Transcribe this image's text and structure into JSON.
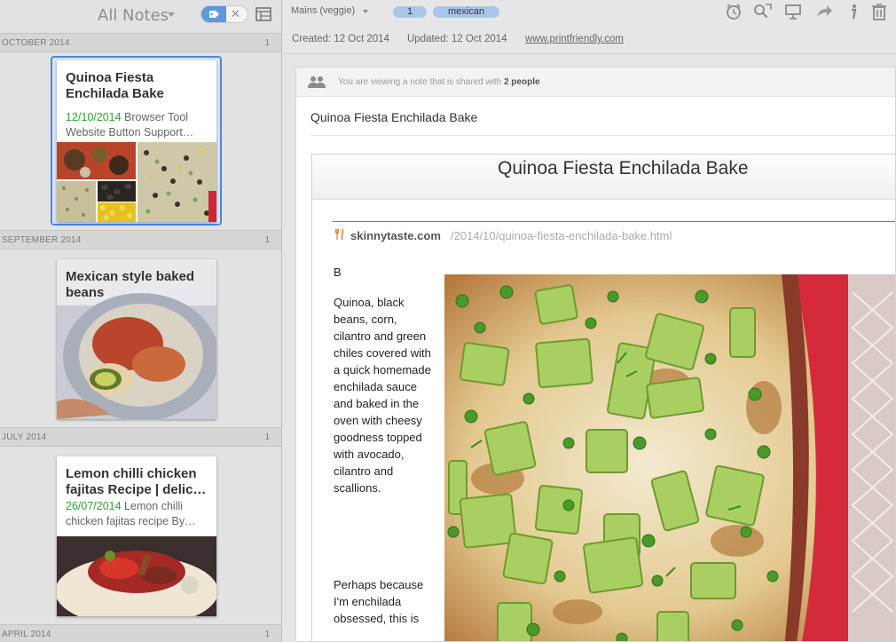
{
  "list": {
    "title": "All Notes",
    "groups": [
      {
        "month": "OCTOBER 2014",
        "count": "1"
      },
      {
        "month": "SEPTEMBER 2014",
        "count": "1"
      },
      {
        "month": "JULY 2014",
        "count": "1"
      },
      {
        "month": "APRIL 2014",
        "count": "1"
      }
    ],
    "notes": [
      {
        "title": "Quinoa Fiesta Enchilada Bake",
        "date": "12/10/2014",
        "snippet": " Browser Tool Website Button Support…"
      },
      {
        "title": "Mexican style baked beans"
      },
      {
        "title": "Lemon chilli chicken fajitas Recipe | delic…",
        "date": "26/07/2014",
        "snippet": " Lemon chilli chicken fajitas recipe By…"
      }
    ]
  },
  "note": {
    "notebook": "Mains (veggie)",
    "tags": [
      "1",
      "mexican"
    ],
    "created": "Created: 12 Oct 2014",
    "updated": "Updated: 12 Oct 2014",
    "source": "www.printfriendly.com",
    "share_prefix": "You are viewing a note that is shared with ",
    "share_people": "2 people",
    "title": "Quinoa Fiesta Enchilada Bake",
    "web": {
      "title": "Quinoa Fiesta Enchilada Bake",
      "site": "skinnytaste.com",
      "path": "/2014/10/quinoa-fiesta-enchilada-bake.html",
      "b": "B",
      "p1": "Quinoa, black beans, corn, cilantro and green chiles covered with a quick homemade enchilada sauce and baked in the oven with cheesy goodness topped with avocado, cilantro and scallions.",
      "p2": "Perhaps because I'm enchilada obsessed, this is"
    }
  },
  "icons": [
    "tag-icon",
    "close-icon",
    "list-view-icon",
    "reminder-icon",
    "share-icon",
    "present-icon",
    "forward-icon",
    "info-icon",
    "trash-icon",
    "people-icon"
  ]
}
